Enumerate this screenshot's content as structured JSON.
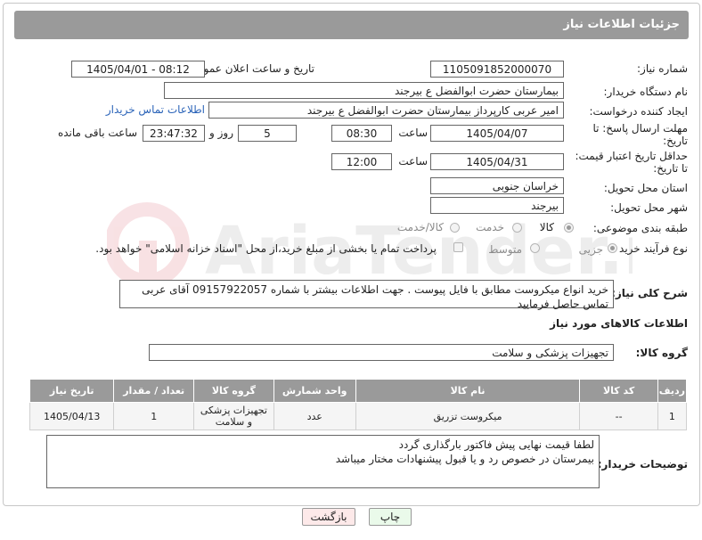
{
  "header": {
    "title": "جزئیات اطلاعات نیاز"
  },
  "need_number": {
    "label": "شماره نیاز:",
    "value": "1105091852000070"
  },
  "announce_datetime": {
    "label": "تاریخ و ساعت اعلان عمومی:",
    "value": "1405/04/01 - 08:12"
  },
  "buyer_org": {
    "label": "نام دستگاه خریدار:",
    "value": "بیمارستان حضرت ابوالفضل  ع  بیرجند"
  },
  "requester": {
    "label": "ایجاد کننده درخواست:",
    "value": "امیر عربی کارپرداز بیمارستان حضرت ابوالفضل  ع  بیرجند",
    "contact_link": "اطلاعات تماس خریدار"
  },
  "reply_deadline": {
    "label_line1": "مهلت ارسال پاسخ: تا",
    "label_line2": "تاریخ:",
    "date": "1405/04/07",
    "time_label": "ساعت",
    "time": "08:30",
    "days": "5",
    "days_label": "روز و",
    "remaining": "23:47:32",
    "remaining_label": "ساعت باقی مانده"
  },
  "price_validity": {
    "label_line1": "حداقل تاریخ اعتبار قیمت:",
    "label_line2": "تا تاریخ:",
    "date": "1405/04/31",
    "time_label": "ساعت",
    "time": "12:00"
  },
  "delivery_province": {
    "label": "استان محل تحویل:",
    "value": "خراسان جنوبی"
  },
  "delivery_city": {
    "label": "شهر محل تحویل:",
    "value": "بیرجند"
  },
  "category": {
    "label": "طبقه بندی موضوعی:",
    "options": [
      "کالا",
      "خدمت",
      "کالا/خدمت"
    ],
    "selected": "کالا"
  },
  "purchase_process": {
    "label": "نوع فرآیند خرید :",
    "options": [
      "جزیی",
      "متوسط"
    ],
    "selected": "جزیی",
    "payment_note": "پرداخت تمام یا بخشی از مبلغ خرید،از محل \"اسناد خزانه اسلامی\" خواهد بود."
  },
  "description": {
    "label": "شرح کلی نیاز:",
    "value": "خرید انواع میکروست مطابق با فایل پیوست . جهت اطلاعات بیشتر با شماره 09157922057 آقای عربی تماس حاصل فرمایید"
  },
  "goods_info": {
    "title": "اطلاعات کالاهای مورد نیاز"
  },
  "goods_group": {
    "label": "گروه کالا:",
    "value": "تجهیزات پزشکی و سلامت"
  },
  "table": {
    "headers": [
      "ردیف",
      "کد کالا",
      "نام کالا",
      "واحد شمارش",
      "گروه کالا",
      "تعداد / مقدار",
      "تاریخ نیاز"
    ],
    "rows": [
      [
        "1",
        "--",
        "میکروست تزریق",
        "عدد",
        "تجهیزات پزشکی و سلامت",
        "1",
        "1405/04/13"
      ]
    ]
  },
  "buyer_notes": {
    "label": "توضیحات خریدار:",
    "line1": "لطفا قیمت نهایی پیش فاکتور بارگذاری گردد",
    "line2": "بیمرستان در خصوص رد و یا قبول پیشنهادات مختار میباشد"
  },
  "buttons": {
    "print": "چاپ",
    "back": "بازگشت"
  },
  "watermark_text": "AriaTender.net"
}
